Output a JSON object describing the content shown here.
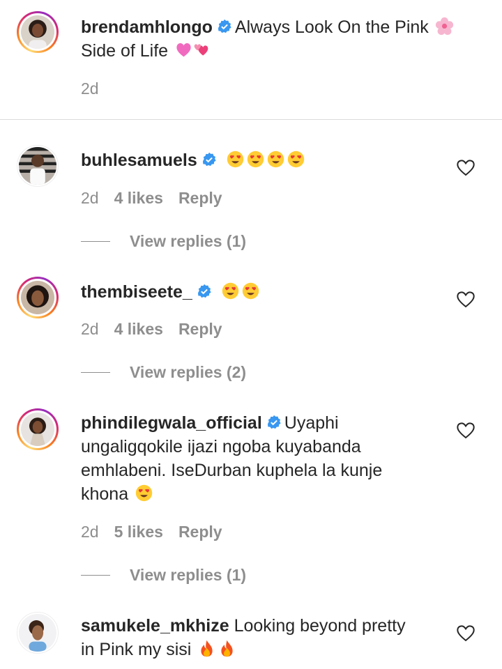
{
  "caption": {
    "username": "brendamhlongo",
    "text": "Always Look On the Pink",
    "text2": "Side of Life",
    "time": "2d",
    "emojis": [
      "cherry-blossom",
      "pink-heart",
      "revolving-hearts"
    ]
  },
  "comments": [
    {
      "username": "buhlesamuels",
      "text": "",
      "emojis": [
        "heart-eyes",
        "heart-eyes",
        "heart-eyes",
        "heart-eyes"
      ],
      "time": "2d",
      "likes": "4 likes",
      "reply": "Reply",
      "view_replies": "View replies (1)"
    },
    {
      "username": "thembiseete_",
      "text": "",
      "emojis": [
        "heart-eyes",
        "heart-eyes"
      ],
      "time": "2d",
      "likes": "4 likes",
      "reply": "Reply",
      "view_replies": "View replies (2)"
    },
    {
      "username": "phindilegwala_official",
      "text_line1": "Uyaphi",
      "text_line2": "ungaligqokile ijazi ngoba kuyabanda",
      "text_line3": "emhlabeni. IseDurban kuphela la kunje",
      "text_line4": "khona",
      "emojis": [
        "heart-eyes"
      ],
      "time": "2d",
      "likes": "5 likes",
      "reply": "Reply",
      "view_replies": "View replies (1)"
    },
    {
      "username": "samukele_mkhize",
      "text_line1": "Looking beyond pretty",
      "text_line2": "in Pink my sisi",
      "emojis": [
        "fire",
        "fire"
      ]
    }
  ],
  "colors": {
    "verified": "#3897f0",
    "meta_text": "#8e8e8e",
    "divider": "#dbdbdb"
  }
}
